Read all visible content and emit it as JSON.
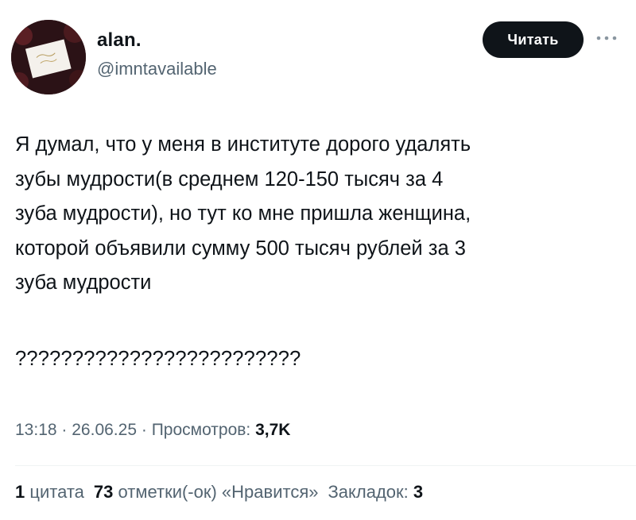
{
  "author": {
    "display_name": "alan.",
    "handle": "@imntavailable"
  },
  "header": {
    "follow_label": "Читать",
    "more_icon": "more-horizontal-icon"
  },
  "tweet": {
    "body": "Я думал, что у меня в институте дорого удалять\nзубы мудрости(в среднем 120-150 тысяч за 4\nзуба мудрости), но тут ко мне пришла женщина,\nкоторой объявили сумму 500 тысяч рублей за 3\nзуба мудрости",
    "question": "?????????????????????????"
  },
  "meta": {
    "time": "13:18",
    "separator": "·",
    "date": "26.06.25",
    "views_label": "Просмотров:",
    "views_count": "3,7K"
  },
  "stats": {
    "quotes_count": "1",
    "quotes_label": "цитата",
    "likes_count": "73",
    "likes_label": "отметки(-ок) «Нравится»",
    "bookmarks_label": "Закладок:",
    "bookmarks_count": "3"
  },
  "colors": {
    "text": "#0f1419",
    "secondary": "#536471",
    "button_bg": "#0f1419",
    "avatar_bg": "#2b1216"
  }
}
